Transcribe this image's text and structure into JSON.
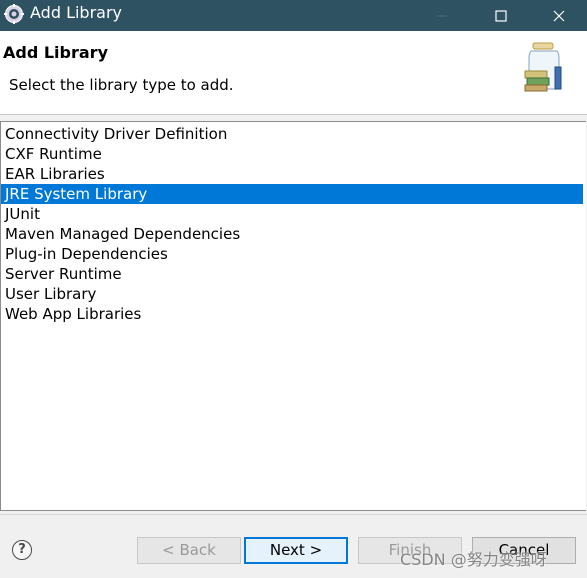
{
  "window": {
    "title": "Add Library",
    "icon": "eclipse-gear-icon"
  },
  "header": {
    "title": "Add Library",
    "subtitle": "Select the library type to add.",
    "art": "library-jar-icon"
  },
  "list": {
    "items": [
      "Connectivity Driver Definition",
      "CXF Runtime",
      "EAR Libraries",
      "JRE System Library",
      "JUnit",
      "Maven Managed Dependencies",
      "Plug-in Dependencies",
      "Server Runtime",
      "User Library",
      "Web App Libraries"
    ],
    "selected": "JRE System Library"
  },
  "buttons": {
    "back": "< Back",
    "next": "Next >",
    "finish": "Finish",
    "cancel": "Cancel",
    "help": "?"
  },
  "watermark": "CSDN @努力变强呀",
  "colors": {
    "titlebar": "#2e5262",
    "selection": "#0078d7"
  }
}
